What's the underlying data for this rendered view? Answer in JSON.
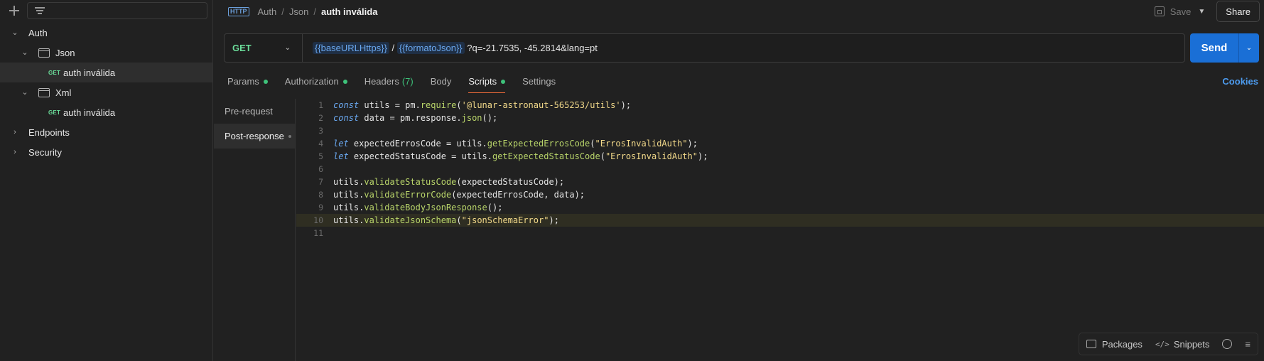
{
  "sidebar": {
    "tree": [
      {
        "label": "Auth",
        "chevron": "v",
        "depth": 0
      },
      {
        "label": "Json",
        "chevron": "v",
        "depth": 1,
        "type": "folder"
      },
      {
        "label": "auth inválida",
        "method": "GET",
        "depth": 2,
        "active": true
      },
      {
        "label": "Xml",
        "chevron": "v",
        "depth": 1,
        "type": "folder"
      },
      {
        "label": "auth inválida",
        "method": "GET",
        "depth": 2
      },
      {
        "label": "Endpoints",
        "chevron": ">",
        "depth": 0
      },
      {
        "label": "Security",
        "chevron": ">",
        "depth": 0
      }
    ]
  },
  "header": {
    "protocol_icon": "HTTP",
    "breadcrumb": [
      "Auth",
      "Json"
    ],
    "breadcrumb_sep": "/",
    "current": "auth inválida",
    "save_label": "Save",
    "share_label": "Share"
  },
  "request": {
    "method": "GET",
    "url_var1": "{{baseURLHttps}}",
    "url_sep": " / ",
    "url_var2": "{{formatoJson}}",
    "url_query": " ?q=-21.7535, -45.2814&lang=pt",
    "send_label": "Send"
  },
  "tabs": {
    "params": "Params",
    "authorization": "Authorization",
    "headers": "Headers",
    "headers_count": "(7)",
    "body": "Body",
    "scripts": "Scripts",
    "settings": "Settings",
    "cookies": "Cookies"
  },
  "script_nav": {
    "pre_request": "Pre-request",
    "post_response": "Post-response"
  },
  "editor": {
    "line_numbers": [
      "1",
      "2",
      "3",
      "4",
      "5",
      "6",
      "7",
      "8",
      "9",
      "10",
      "11"
    ]
  },
  "footer": {
    "packages": "Packages",
    "snippets": "Snippets"
  },
  "colors": {
    "accent_send": "#1a6fd6",
    "method_get": "#6bdd9a",
    "active_tab_underline": "#f26b3a",
    "status_dot": "#3ec27a"
  }
}
